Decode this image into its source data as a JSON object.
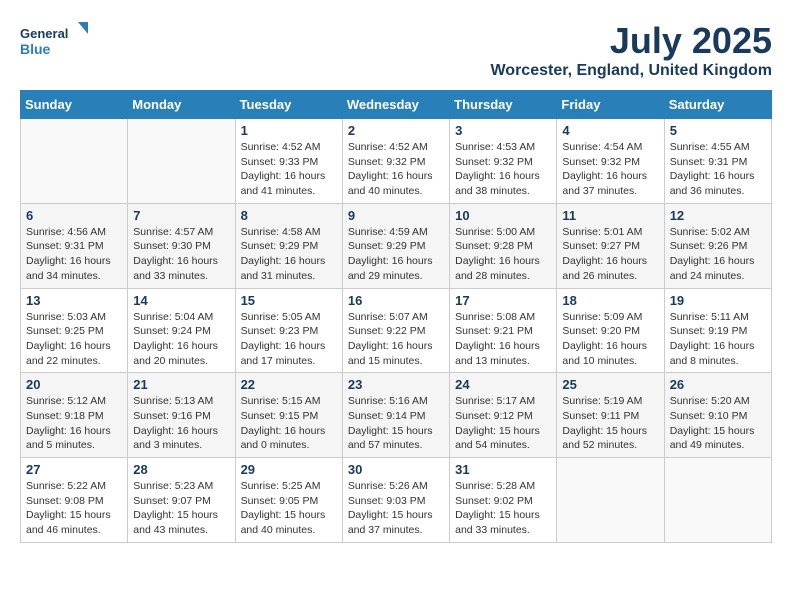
{
  "header": {
    "logo_general": "General",
    "logo_blue": "Blue",
    "month_title": "July 2025",
    "location": "Worcester, England, United Kingdom"
  },
  "weekdays": [
    "Sunday",
    "Monday",
    "Tuesday",
    "Wednesday",
    "Thursday",
    "Friday",
    "Saturday"
  ],
  "weeks": [
    [
      {
        "day": "",
        "info": ""
      },
      {
        "day": "",
        "info": ""
      },
      {
        "day": "1",
        "info": "Sunrise: 4:52 AM\nSunset: 9:33 PM\nDaylight: 16 hours\nand 41 minutes."
      },
      {
        "day": "2",
        "info": "Sunrise: 4:52 AM\nSunset: 9:32 PM\nDaylight: 16 hours\nand 40 minutes."
      },
      {
        "day": "3",
        "info": "Sunrise: 4:53 AM\nSunset: 9:32 PM\nDaylight: 16 hours\nand 38 minutes."
      },
      {
        "day": "4",
        "info": "Sunrise: 4:54 AM\nSunset: 9:32 PM\nDaylight: 16 hours\nand 37 minutes."
      },
      {
        "day": "5",
        "info": "Sunrise: 4:55 AM\nSunset: 9:31 PM\nDaylight: 16 hours\nand 36 minutes."
      }
    ],
    [
      {
        "day": "6",
        "info": "Sunrise: 4:56 AM\nSunset: 9:31 PM\nDaylight: 16 hours\nand 34 minutes."
      },
      {
        "day": "7",
        "info": "Sunrise: 4:57 AM\nSunset: 9:30 PM\nDaylight: 16 hours\nand 33 minutes."
      },
      {
        "day": "8",
        "info": "Sunrise: 4:58 AM\nSunset: 9:29 PM\nDaylight: 16 hours\nand 31 minutes."
      },
      {
        "day": "9",
        "info": "Sunrise: 4:59 AM\nSunset: 9:29 PM\nDaylight: 16 hours\nand 29 minutes."
      },
      {
        "day": "10",
        "info": "Sunrise: 5:00 AM\nSunset: 9:28 PM\nDaylight: 16 hours\nand 28 minutes."
      },
      {
        "day": "11",
        "info": "Sunrise: 5:01 AM\nSunset: 9:27 PM\nDaylight: 16 hours\nand 26 minutes."
      },
      {
        "day": "12",
        "info": "Sunrise: 5:02 AM\nSunset: 9:26 PM\nDaylight: 16 hours\nand 24 minutes."
      }
    ],
    [
      {
        "day": "13",
        "info": "Sunrise: 5:03 AM\nSunset: 9:25 PM\nDaylight: 16 hours\nand 22 minutes."
      },
      {
        "day": "14",
        "info": "Sunrise: 5:04 AM\nSunset: 9:24 PM\nDaylight: 16 hours\nand 20 minutes."
      },
      {
        "day": "15",
        "info": "Sunrise: 5:05 AM\nSunset: 9:23 PM\nDaylight: 16 hours\nand 17 minutes."
      },
      {
        "day": "16",
        "info": "Sunrise: 5:07 AM\nSunset: 9:22 PM\nDaylight: 16 hours\nand 15 minutes."
      },
      {
        "day": "17",
        "info": "Sunrise: 5:08 AM\nSunset: 9:21 PM\nDaylight: 16 hours\nand 13 minutes."
      },
      {
        "day": "18",
        "info": "Sunrise: 5:09 AM\nSunset: 9:20 PM\nDaylight: 16 hours\nand 10 minutes."
      },
      {
        "day": "19",
        "info": "Sunrise: 5:11 AM\nSunset: 9:19 PM\nDaylight: 16 hours\nand 8 minutes."
      }
    ],
    [
      {
        "day": "20",
        "info": "Sunrise: 5:12 AM\nSunset: 9:18 PM\nDaylight: 16 hours\nand 5 minutes."
      },
      {
        "day": "21",
        "info": "Sunrise: 5:13 AM\nSunset: 9:16 PM\nDaylight: 16 hours\nand 3 minutes."
      },
      {
        "day": "22",
        "info": "Sunrise: 5:15 AM\nSunset: 9:15 PM\nDaylight: 16 hours\nand 0 minutes."
      },
      {
        "day": "23",
        "info": "Sunrise: 5:16 AM\nSunset: 9:14 PM\nDaylight: 15 hours\nand 57 minutes."
      },
      {
        "day": "24",
        "info": "Sunrise: 5:17 AM\nSunset: 9:12 PM\nDaylight: 15 hours\nand 54 minutes."
      },
      {
        "day": "25",
        "info": "Sunrise: 5:19 AM\nSunset: 9:11 PM\nDaylight: 15 hours\nand 52 minutes."
      },
      {
        "day": "26",
        "info": "Sunrise: 5:20 AM\nSunset: 9:10 PM\nDaylight: 15 hours\nand 49 minutes."
      }
    ],
    [
      {
        "day": "27",
        "info": "Sunrise: 5:22 AM\nSunset: 9:08 PM\nDaylight: 15 hours\nand 46 minutes."
      },
      {
        "day": "28",
        "info": "Sunrise: 5:23 AM\nSunset: 9:07 PM\nDaylight: 15 hours\nand 43 minutes."
      },
      {
        "day": "29",
        "info": "Sunrise: 5:25 AM\nSunset: 9:05 PM\nDaylight: 15 hours\nand 40 minutes."
      },
      {
        "day": "30",
        "info": "Sunrise: 5:26 AM\nSunset: 9:03 PM\nDaylight: 15 hours\nand 37 minutes."
      },
      {
        "day": "31",
        "info": "Sunrise: 5:28 AM\nSunset: 9:02 PM\nDaylight: 15 hours\nand 33 minutes."
      },
      {
        "day": "",
        "info": ""
      },
      {
        "day": "",
        "info": ""
      }
    ]
  ]
}
